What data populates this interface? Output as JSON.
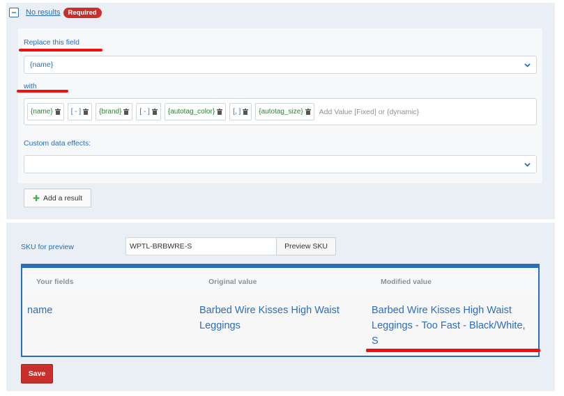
{
  "rule": {
    "no_results_label": "No results",
    "required_badge": "Required",
    "replace_label": "Replace this field",
    "replace_value": "{name}",
    "with_label": "with",
    "tags": [
      {
        "text": "{name}",
        "kind": "dynamic"
      },
      {
        "text": "[ - ]",
        "kind": "fixed"
      },
      {
        "text": "{brand}",
        "kind": "dynamic"
      },
      {
        "text": "[ - ]",
        "kind": "fixed"
      },
      {
        "text": "{autotag_color}",
        "kind": "dynamic"
      },
      {
        "text": "[, ]",
        "kind": "fixed"
      },
      {
        "text": "{autotag_size}",
        "kind": "dynamic"
      }
    ],
    "add_value_placeholder": "Add Value [Fixed] or {dynamic}",
    "custom_effects_label": "Custom data effects:",
    "custom_effects_value": "",
    "add_result_label": "Add a result"
  },
  "preview": {
    "sku_label": "SKU for preview",
    "sku_value": "WPTL-BRBWRE-S",
    "preview_button": "Preview SKU",
    "columns": [
      "Your fields",
      "Original value",
      "Modified value"
    ],
    "row": {
      "field": "name",
      "original_line1": "Barbed Wire Kisses High Waist",
      "original_line2": "Leggings",
      "modified_line1": "Barbed Wire Kisses High Waist",
      "modified_line2": "Leggings - Too Fast - Black/White,",
      "modified_line3": "S"
    },
    "save_label": "Save"
  },
  "colors": {
    "link_blue": "#2a6ebb",
    "required_red": "#c9302c",
    "dynamic_green": "#2e7d32",
    "annotation_red": "#ee1111",
    "panel_bg": "#e9eff4"
  }
}
